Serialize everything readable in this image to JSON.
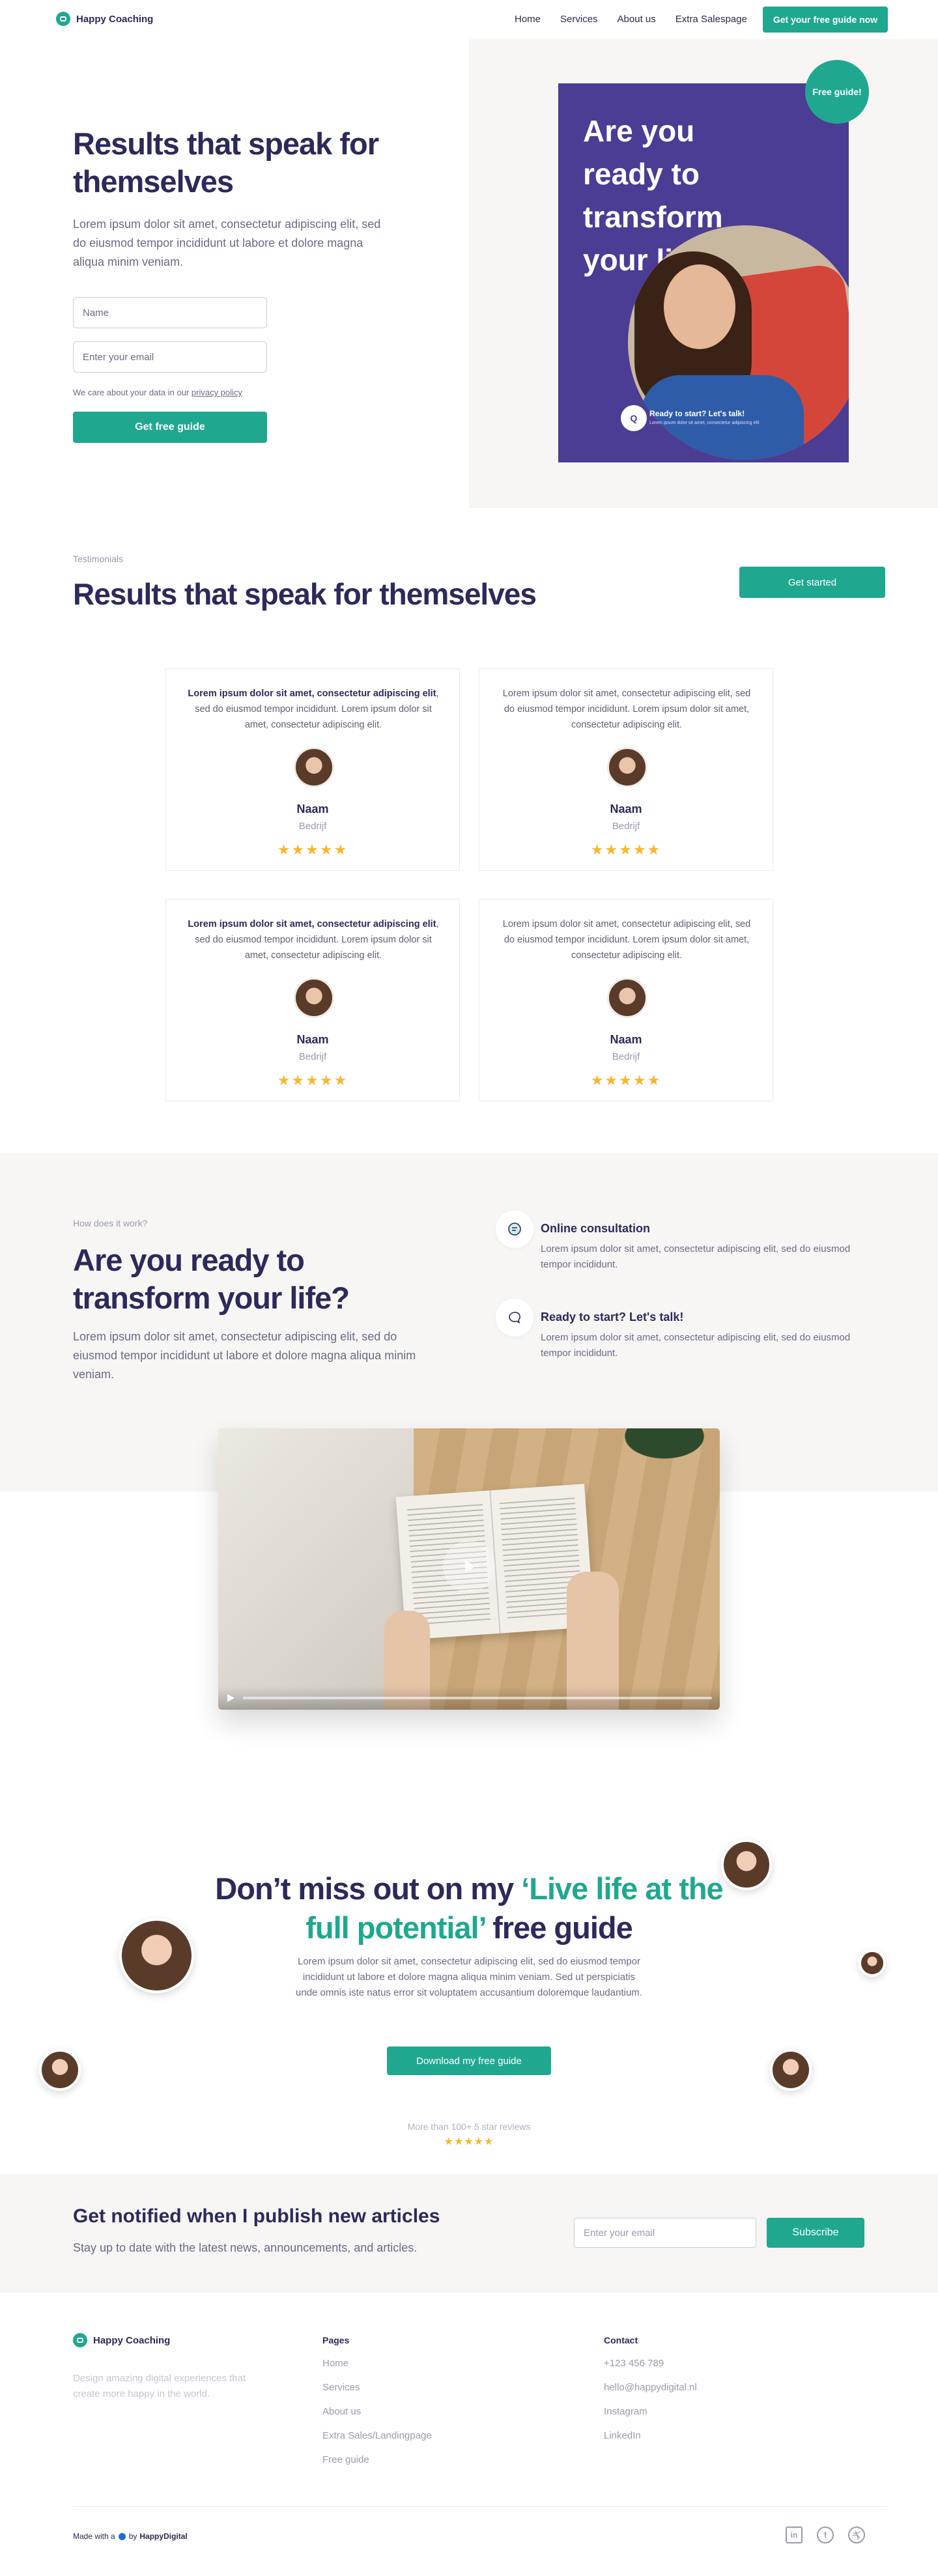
{
  "header": {
    "logo_text": "Happy Coaching",
    "nav": [
      "Home",
      "Services",
      "About us",
      "Extra Salespage"
    ],
    "cta": "Get your free guide now"
  },
  "hero": {
    "title": "Results that speak for themselves",
    "text": "Lorem ipsum dolor sit amet, consectetur adipiscing elit, sed do eiusmod tempor incididunt ut labore et dolore magna aliqua minim veniam.",
    "name_placeholder": "Name",
    "email_placeholder": "Enter your email",
    "privacy_prefix": "We care about your data in our",
    "privacy_link": "privacy policy",
    "button": "Get free guide",
    "cover_title": "Are you ready to transform your life?",
    "cover_caption": "Ready to start? Let's talk!",
    "cover_subcaption": "Lorem ipsum dolor sit amet, consectetur adipiscing elit",
    "badge": "Free guide!"
  },
  "testimonials": {
    "eyebrow": "Testimonials",
    "title": "Results that speak for themselves",
    "button": "Get started",
    "items": [
      {
        "bold": "Lorem ipsum dolor sit amet, consectetur adipiscing elit",
        "text": ", sed do eiusmod tempor incididunt. Lorem ipsum dolor sit amet, consectetur adipiscing elit.",
        "name": "Naam",
        "company": "Bedrijf",
        "stars": "★★★★★"
      },
      {
        "bold": "",
        "text": "Lorem ipsum dolor sit amet, consectetur adipiscing elit, sed do eiusmod tempor incididunt. Lorem ipsum dolor sit amet, consectetur adipiscing elit.",
        "name": "Naam",
        "company": "Bedrijf",
        "stars": "★★★★★"
      },
      {
        "bold": "Lorem ipsum dolor sit amet, consectetur adipiscing elit",
        "text": ", sed do eiusmod tempor incididunt. Lorem ipsum dolor sit amet, consectetur adipiscing elit.",
        "name": "Naam",
        "company": "Bedrijf",
        "stars": "★★★★★"
      },
      {
        "bold": "",
        "text": "Lorem ipsum dolor sit amet, consectetur adipiscing elit, sed do eiusmod tempor incididunt. Lorem ipsum dolor sit amet, consectetur adipiscing elit.",
        "name": "Naam",
        "company": "Bedrijf",
        "stars": "★★★★★"
      }
    ]
  },
  "how": {
    "eyebrow": "How does it work?",
    "title": "Are you ready to transform your life?",
    "text": "Lorem ipsum dolor sit amet, consectetur adipiscing elit, sed do eiusmod tempor incididunt ut labore et dolore magna aliqua minim veniam.",
    "features": [
      {
        "title": "Online consultation",
        "text": "Lorem ipsum dolor sit amet, consectetur adipiscing elit, sed do eiusmod tempor incididunt."
      },
      {
        "title": "Ready to start? Let's talk!",
        "text": "Lorem ipsum dolor sit amet, consectetur adipiscing elit, sed do eiusmod tempor incididunt."
      }
    ]
  },
  "guide": {
    "title_before": "Don’t miss out on my ",
    "title_highlight": "‘Live life at the full potential’",
    "title_after": " free guide",
    "text": "Lorem ipsum dolor sit amet, consectetur adipiscing elit, sed do eiusmod tempor incididunt ut labore et dolore magna aliqua minim veniam.  Sed ut perspiciatis unde omnis iste natus error sit voluptatem accusantium doloremque laudantium.",
    "button": "Download my free guide",
    "reviews": "More than 100+ 5 star reviews",
    "stars": "★★★★★"
  },
  "newsletter": {
    "title": "Get notified when I publish new articles",
    "text": "Stay up to date with the latest news, announcements, and articles.",
    "placeholder": "Enter your email",
    "button": "Subscribe"
  },
  "footer": {
    "logo_text": "Happy Coaching",
    "tagline": "Design amazing digital experiences that create more happy in the world.",
    "pages_title": "Pages",
    "pages": [
      "Home",
      "Services",
      "About us",
      "Extra Sales/Landingpage",
      "Free guide"
    ],
    "contact_title": "Contact",
    "contact": [
      "+123 456 789",
      "hello@happydigital.nl",
      "Instagram",
      "LinkedIn"
    ],
    "made_prefix": "Made with a",
    "made_by": "by",
    "made_brand": "HappyDigital",
    "social": [
      "linkedin-icon",
      "facebook-icon",
      "dribbble-icon"
    ]
  },
  "colors": {
    "accent": "#1fa88f",
    "navy": "#2c2a5a",
    "cover": "#4b3c94",
    "star": "#f5b82e"
  }
}
